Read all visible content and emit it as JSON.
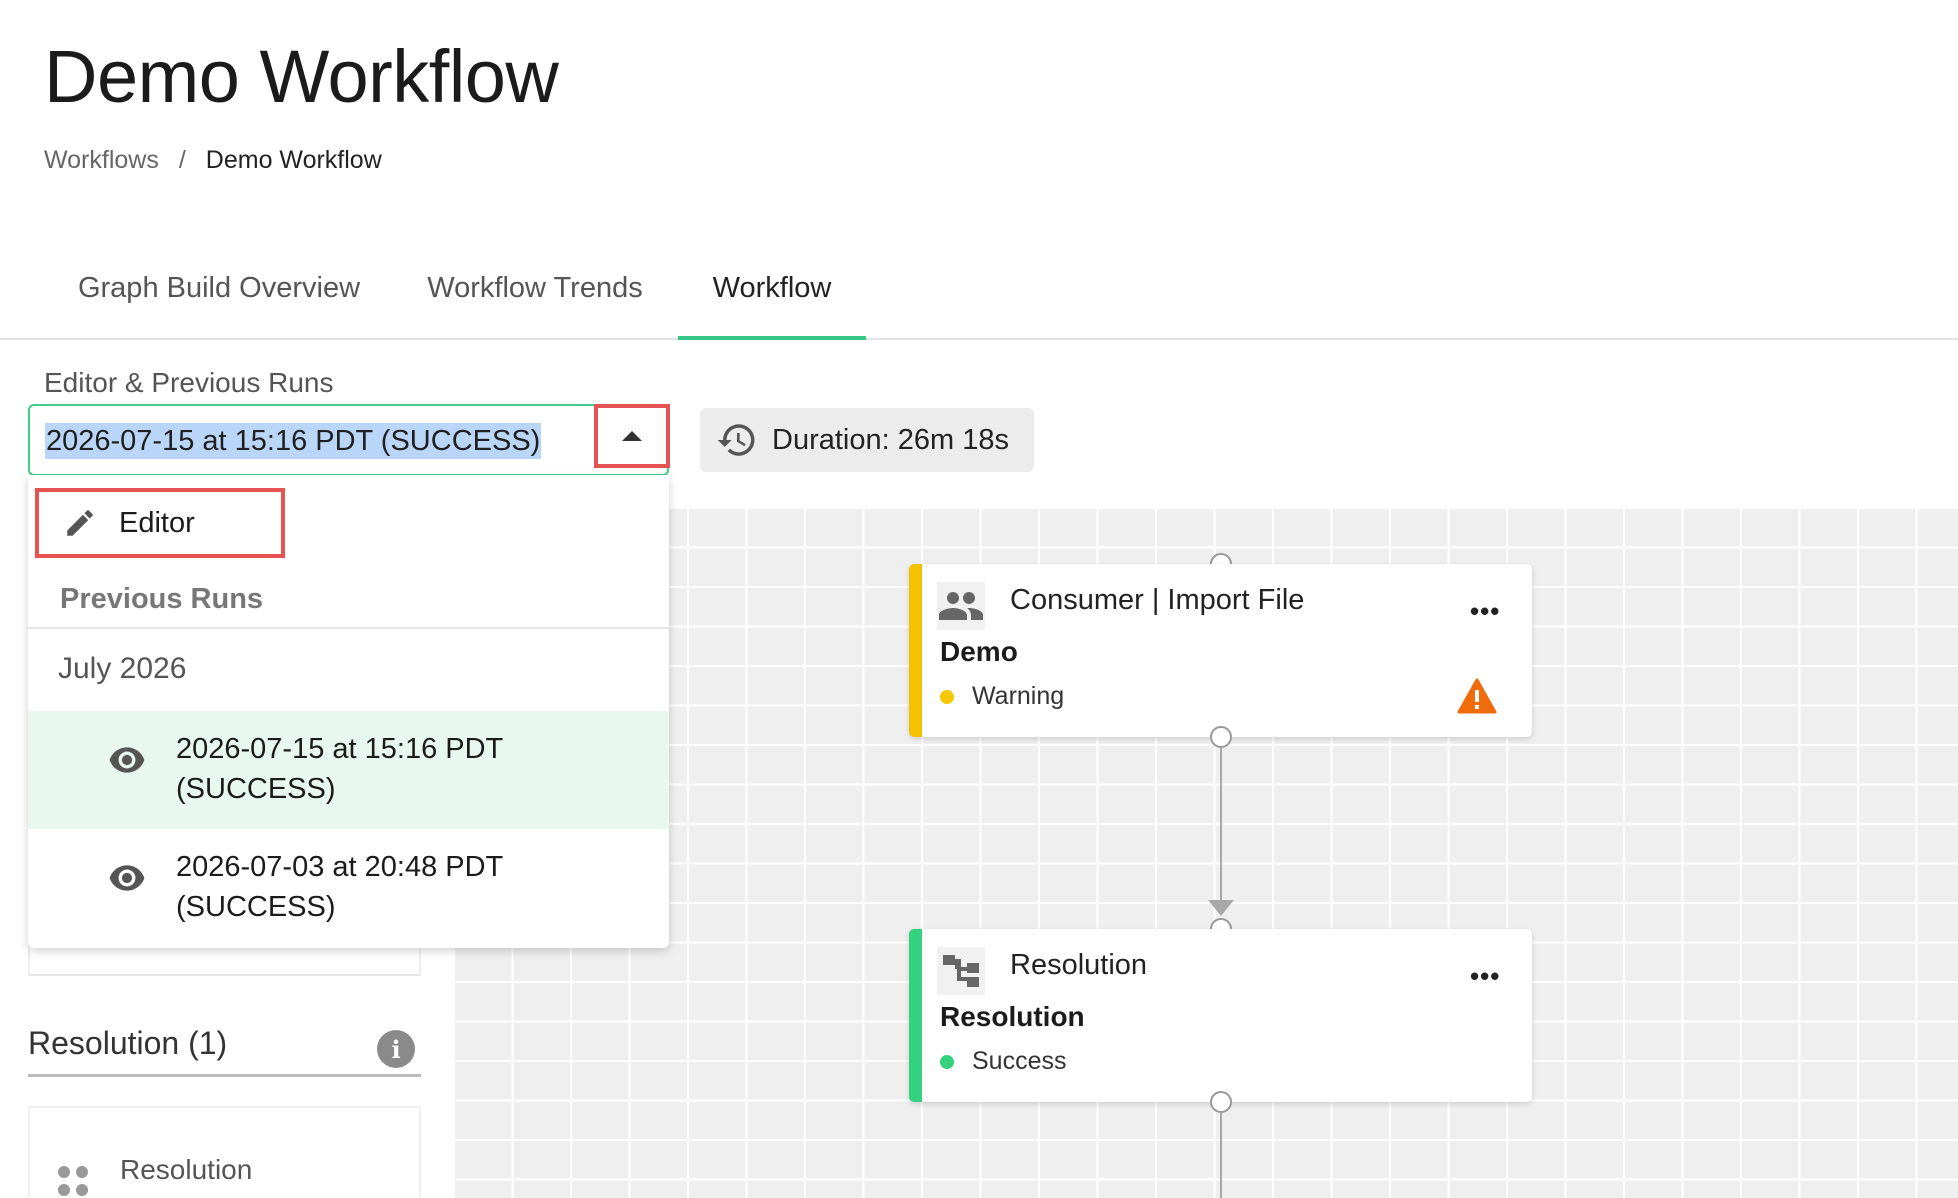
{
  "page": {
    "title": "Demo Workflow",
    "breadcrumb": {
      "root": "Workflows",
      "separator": "/",
      "current": "Demo Workflow"
    }
  },
  "tabs": [
    {
      "label": "Graph Build Overview",
      "active": false
    },
    {
      "label": "Workflow Trends",
      "active": false
    },
    {
      "label": "Workflow",
      "active": true
    }
  ],
  "run_selector": {
    "label": "Editor & Previous Runs",
    "selected_value": "2026-07-15 at 15:16 PDT (SUCCESS)",
    "toggle_icon": "chevron-up-icon"
  },
  "duration": {
    "icon": "history-icon",
    "text": "Duration: 26m 18s"
  },
  "dropdown": {
    "editor_label": "Editor",
    "editor_icon": "pencil-icon",
    "previous_runs_header": "Previous Runs",
    "month": "July 2026",
    "runs": [
      {
        "line1": "2026-07-15 at 15:16 PDT",
        "line2": "(SUCCESS)",
        "selected": true
      },
      {
        "line1": "2026-07-03 at 20:48 PDT",
        "line2": "(SUCCESS)",
        "selected": false
      }
    ]
  },
  "left_panel": {
    "section_title": "Resolution (1)",
    "info_icon": "i",
    "item_label": "Resolution"
  },
  "nodes": [
    {
      "icon": "users-icon",
      "title": "Consumer | Import File",
      "subtitle": "Demo",
      "status": "Warning",
      "status_color": "#f5c800",
      "bar_color": "#f5c000",
      "more": "•••",
      "has_warning_icon": true
    },
    {
      "icon": "resolution-icon",
      "title": "Resolution",
      "subtitle": "Resolution",
      "status": "Success",
      "status_color": "#34d17f",
      "bar_color": "#34d17f",
      "more": "•••",
      "has_warning_icon": false
    }
  ],
  "colors": {
    "accent": "#34c785",
    "highlight_box": "#e55353",
    "selection": "#b9d6f8",
    "warning_icon": "#f06b0a"
  }
}
